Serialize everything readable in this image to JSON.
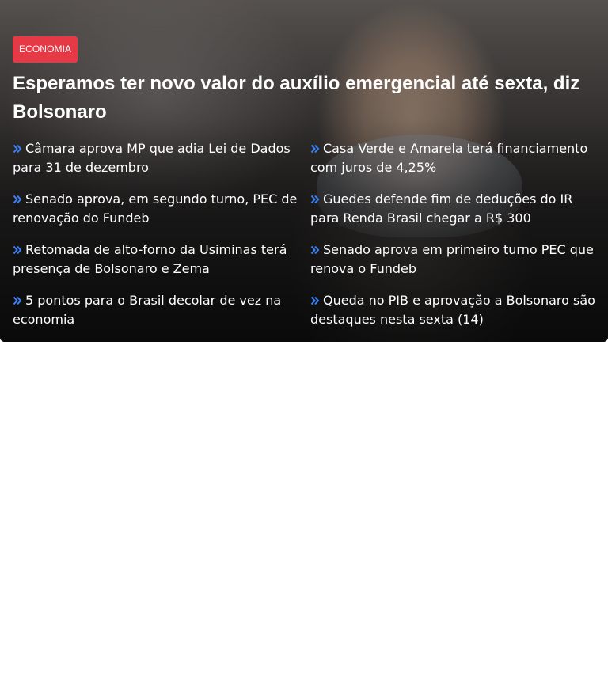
{
  "hero": {
    "category_label": "ECONOMIA",
    "headline": "Esperamos ter novo valor do auxílio emergencial até sexta, diz Bolsonaro",
    "arrow_icon": "double-chevron-right-icon",
    "arrow_color": "#3b82f6",
    "badge_color": "#e63946",
    "related": [
      {
        "title": "Câmara aprova MP que adia Lei de Dados para 31 de dezembro"
      },
      {
        "title": "Casa Verde e Amarela terá financiamento com juros de 4,25%"
      },
      {
        "title": "Senado aprova, em segundo turno, PEC de renovação do Fundeb"
      },
      {
        "title": "Guedes defende fim de deduções do IR para Renda Brasil chegar a R$ 300"
      },
      {
        "title": "Retomada de alto-forno da Usiminas terá presença de Bolsonaro e Zema"
      },
      {
        "title": "Senado aprova em primeiro turno PEC que renova o Fundeb"
      },
      {
        "title": "5 pontos para o Brasil decolar de vez na economia"
      },
      {
        "title": "Queda no PIB e aprovação a Bolsonaro são destaques nesta sexta (14)"
      }
    ]
  }
}
